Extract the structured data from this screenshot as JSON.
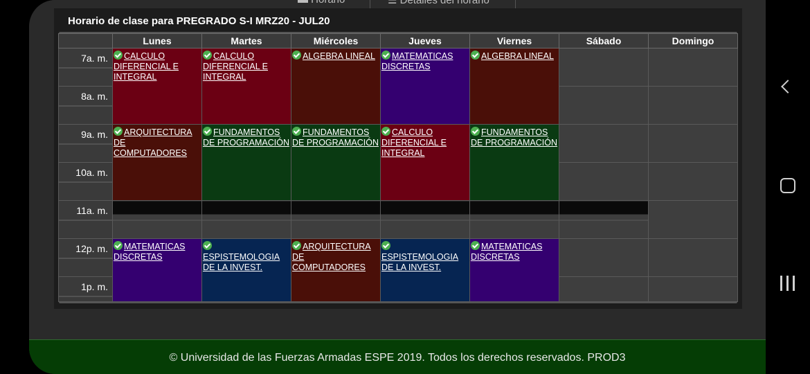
{
  "tabs": {
    "horario_label": "Horario",
    "detalles_label": "Detalles del horario"
  },
  "panel": {
    "title": "Horario de clase para PREGRADO S-I MRZ20 - JUL20"
  },
  "days": [
    "Lunes",
    "Martes",
    "Miércoles",
    "Jueves",
    "Viernes",
    "Sábado",
    "Domingo"
  ],
  "hours": [
    "7a. m.",
    "8a. m.",
    "9a. m.",
    "10a. m.",
    "11a. m.",
    "12p. m.",
    "1p. m."
  ],
  "courses": {
    "mon_7": {
      "line1": "CALCULO",
      "line2": "DIFERENCIAL E",
      "line3": "INTEGRAL"
    },
    "tue_7": {
      "line1": "CALCULO",
      "line2": "DIFERENCIAL E",
      "line3": "INTEGRAL"
    },
    "wed_7": {
      "line1": "ALGEBRA LINEAL",
      "line2": "",
      "line3": ""
    },
    "thu_7": {
      "line1": "MATEMATICAS",
      "line2": "DISCRETAS",
      "line3": ""
    },
    "fri_7": {
      "line1": "ALGEBRA LINEAL",
      "line2": "",
      "line3": ""
    },
    "mon_9": {
      "line1": "ARQUITECTURA",
      "line2": "DE COMPUTADORES",
      "line3": ""
    },
    "tue_9": {
      "line1": "FUNDAMENTOS",
      "line2": "DE PROGRAMACIÓN",
      "line3": ""
    },
    "wed_9": {
      "line1": "FUNDAMENTOS",
      "line2": "DE PROGRAMACIÓN",
      "line3": ""
    },
    "thu_9": {
      "line1": "CALCULO",
      "line2": "DIFERENCIAL E",
      "line3": "INTEGRAL"
    },
    "fri_9": {
      "line1": "FUNDAMENTOS",
      "line2": "DE PROGRAMACIÓN",
      "line3": ""
    },
    "mon_12": {
      "line1": "MATEMATICAS",
      "line2": "DISCRETAS",
      "line3": ""
    },
    "tue_12": {
      "line1": "ESPISTEMOLOGIA",
      "line2": "DE LA INVEST.",
      "line3": ""
    },
    "wed_12": {
      "line1": "ARQUITECTURA",
      "line2": "DE COMPUTADORES",
      "line3": ""
    },
    "thu_12": {
      "line1": "ESPISTEMOLOGIA",
      "line2": "DE LA INVEST.",
      "line3": ""
    },
    "fri_12": {
      "line1": "MATEMATICAS",
      "line2": "DISCRETAS",
      "line3": ""
    }
  },
  "colors": {
    "calculo": "#6b0013",
    "algebra": "#4a0f08",
    "matematicas": "#340070",
    "fundamentos": "#0a3a12",
    "epistemologia": "#062552",
    "arquitectura": "#4a0f08",
    "footer": "#053d05"
  },
  "footer": {
    "text": "© Universidad de las Fuerzas Armadas ESPE 2019. Todos los derechos reservados. PROD3"
  },
  "nav": {
    "back_icon": "chevron-left-icon",
    "home_icon": "home-square-icon",
    "recents_icon": "recents-bars-icon"
  }
}
